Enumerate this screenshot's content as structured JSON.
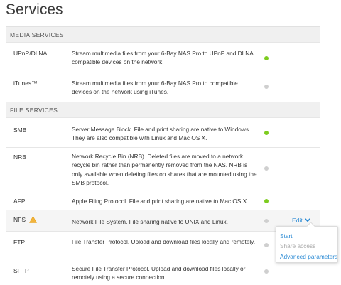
{
  "page": {
    "title": "Services"
  },
  "sections": {
    "media": "MEDIA SERVICES",
    "file": "FILE SERVICES"
  },
  "services": [
    {
      "name": "UPnP/DLNA",
      "description": "Stream multimedia files from your 6-Bay NAS Pro to UPnP and DLNA compatible devices on the network.",
      "status": "on"
    },
    {
      "name": "iTunes™",
      "description": "Stream multimedia files from your 6-Bay NAS Pro to compatible devices on the network using iTunes.",
      "status": "off"
    },
    {
      "name": "SMB",
      "description": "Server Message Block. File and print sharing are native to Windows. They are also compatible with Linux and Mac OS X.",
      "status": "on"
    },
    {
      "name": "NRB",
      "description": "Network Recycle Bin (NRB). Deleted files are moved to a network recycle bin rather than permanently removed from the NAS. NRB is only available when deleting files on shares that are mounted using the SMB protocol.",
      "status": "off"
    },
    {
      "name": "AFP",
      "description": "Apple Filing Protocol. File and print sharing are native to Mac OS X.",
      "status": "on"
    },
    {
      "name": "NFS",
      "description": "Network File System. File sharing native to UNIX and Linux.",
      "status": "off",
      "warning": true
    },
    {
      "name": "FTP",
      "description": "File Transfer Protocol. Upload and download files locally and remotely.",
      "status": "off"
    },
    {
      "name": "SFTP",
      "description": "Secure File Transfer Protocol. Upload and download files locally or remotely using a secure connection.",
      "status": "off"
    }
  ],
  "edit": {
    "label": "Edit"
  },
  "menu": {
    "start": "Start",
    "share_access": "Share access",
    "advanced": "Advanced parameters"
  },
  "colors": {
    "status_on": "#7dcc1f",
    "status_off": "#cfcfcf",
    "link": "#2a8ad4"
  },
  "icons": {
    "warning": "warning-icon",
    "edit_chevron": "chevron-down-icon"
  }
}
